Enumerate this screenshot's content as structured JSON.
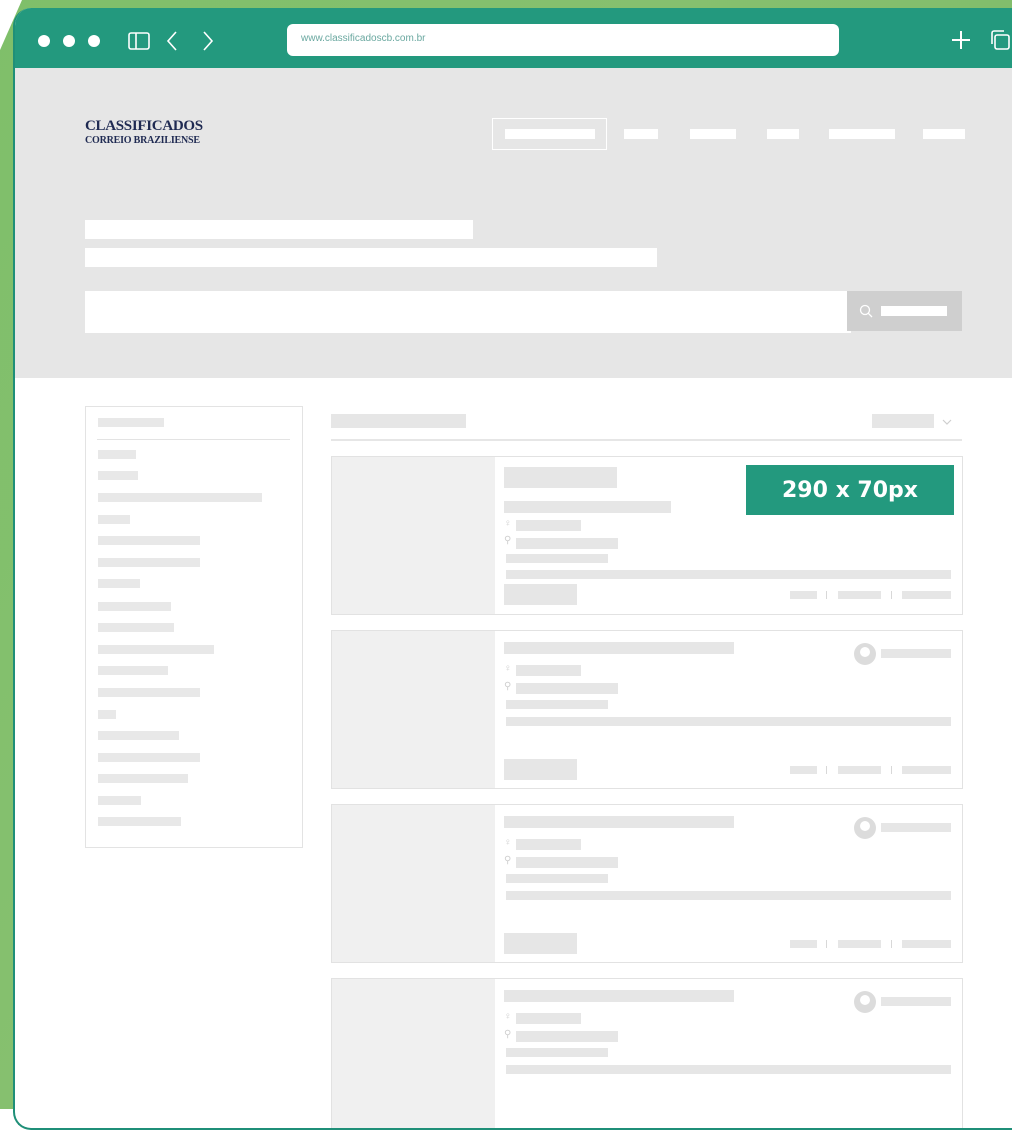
{
  "browser": {
    "url": "www.classificadoscb.com.br",
    "icons": {
      "sidebar": "sidebar-toggle-icon",
      "back": "chevron-left-icon",
      "forward": "chevron-right-icon",
      "new_tab": "plus-icon",
      "tabs": "tabs-icon"
    }
  },
  "header": {
    "logo_line1": "CLASSIFICADOS",
    "logo_line2": "CORREIO BRAZILIENSE"
  },
  "search": {
    "icon": "search-icon",
    "value": "",
    "placeholder": ""
  },
  "results": {
    "sort_icon": "chevron-down-icon"
  },
  "ad_banner": {
    "label": "290 x 70px"
  },
  "colors": {
    "brand_green": "#23997e",
    "frame_green": "#7fbf6a",
    "logo_navy": "#1f2a52",
    "placeholder_gray": "#e6e6e6"
  }
}
